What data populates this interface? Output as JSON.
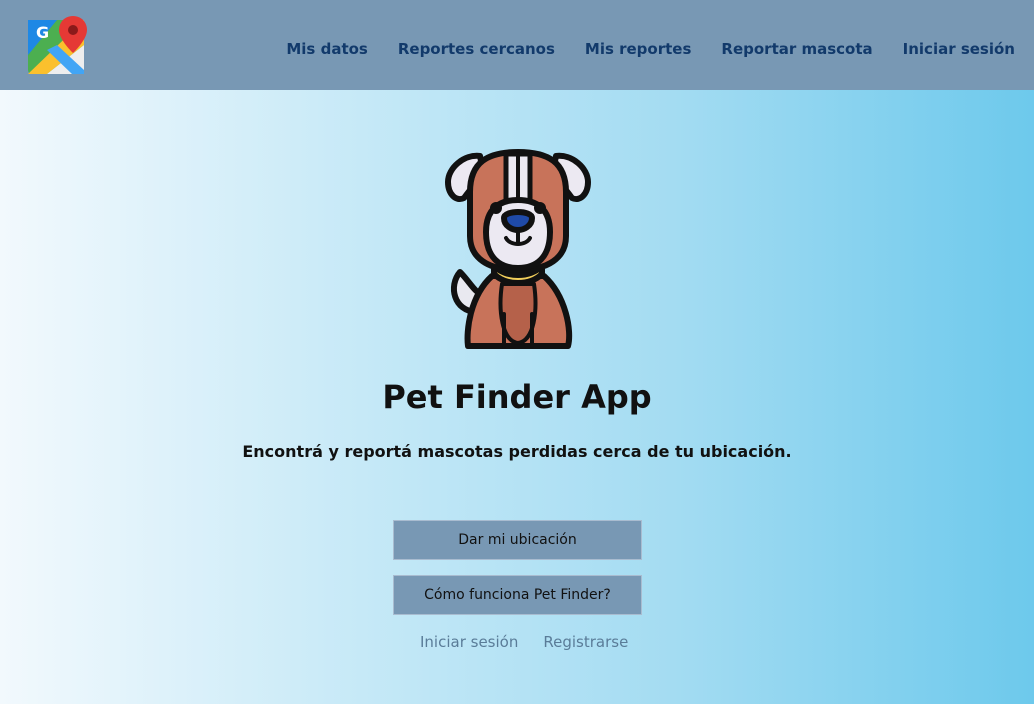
{
  "header": {
    "logo_icon": "google-maps-icon",
    "nav": [
      "Mis datos",
      "Reportes cercanos",
      "Mis reportes",
      "Reportar mascota",
      "Iniciar sesión"
    ]
  },
  "hero": {
    "illustration_icon": "dog-icon",
    "title": "Pet Finder App",
    "subtitle": "Encontrá y reportá mascotas perdidas cerca de tu ubicación."
  },
  "actions": {
    "primary": "Dar mi ubicación",
    "secondary": "Cómo funciona Pet Finder?"
  },
  "auth_links": {
    "login": "Iniciar sesión",
    "register": "Registrarse"
  },
  "colors": {
    "header_bg": "#7898b4",
    "nav_text": "#123a6b",
    "button_bg": "#7898b4",
    "link_text": "#5a7c98"
  }
}
